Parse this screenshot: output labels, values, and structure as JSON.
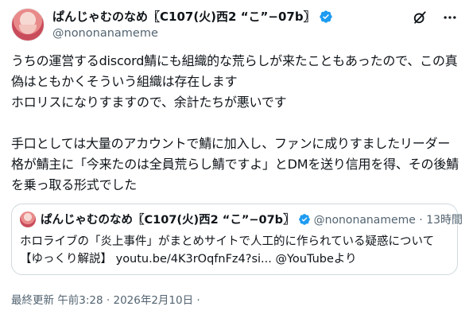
{
  "author": {
    "display_name": "ぱんじゃむのなめ〖C107(火)西2 “こ”−07b〗",
    "handle": "@nononanameme"
  },
  "header_icons": [
    "grok-icon",
    "more-icon"
  ],
  "tweet": {
    "text": "うちの運営するdiscord鯖にも組織的な荒らしが来たこともあったので、この真偽はともかくそういう組織は存在します\nホロリスになりすますので、余計たちが悪いです\n\n手口としては大量のアカウントで鯖に加入し、ファンに成りすましたリーダー格が鯖主に「今来たのは全員荒らし鯖ですよ」とDMを送り信用を得、その後鯖を乗っ取る形式でした"
  },
  "quote": {
    "display_name": "ぱんじゃむのなめ〖C107(火)西2 “こ”−07b〗",
    "meta": "@nononanameme · 13時間",
    "text": "ホロライブの「炎上事件」がまとめサイトで人工的に作られている疑惑について\n【ゆっくり解説】 youtu.be/4K3rOqfnFz4?si... @YouTubeより"
  },
  "footer": {
    "timestamp": "最終更新 午前3:28 · 2026年2月10日 ·"
  },
  "colors": {
    "verified": "#1d9bf0",
    "secondary_text": "#536471",
    "border": "#cfd9de"
  }
}
